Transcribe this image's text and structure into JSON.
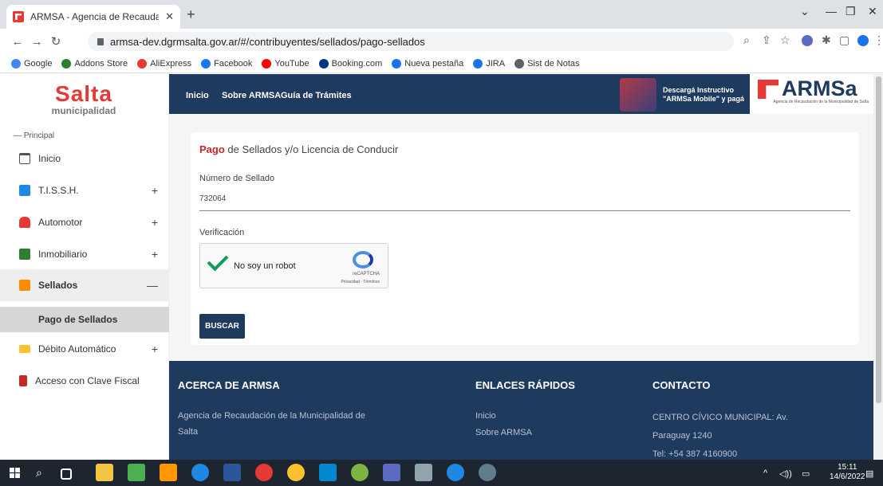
{
  "browser": {
    "tab_title": "ARMSA - Agencia de Recaudació",
    "tab_close": "✕",
    "new_tab": "+",
    "url": "armsa-dev.dgrmsalta.gov.ar/#/contribuyentes/sellados/pago-sellados",
    "window_controls": [
      "⌄",
      "—",
      "❐",
      "✕"
    ],
    "bookmarks": [
      {
        "label": "Google",
        "color": "#4285f4"
      },
      {
        "label": "Addons Store",
        "color": "#2e7d32"
      },
      {
        "label": "AliExpress",
        "color": "#e53935"
      },
      {
        "label": "Facebook",
        "color": "#1877f2"
      },
      {
        "label": "YouTube",
        "color": "#ff0000"
      },
      {
        "label": "Booking.com",
        "color": "#003580"
      },
      {
        "label": "Nueva pestaña",
        "color": "#1a73e8"
      },
      {
        "label": "JIRA",
        "color": "#1a73e8"
      },
      {
        "label": "Sist de Notas",
        "color": "#5f6368"
      }
    ]
  },
  "logo": {
    "big": "Salta",
    "small": "municipalidad"
  },
  "sidebar": {
    "section": "— Principal",
    "items": [
      {
        "label": "Inicio",
        "icon": "home-icon",
        "color": "#555",
        "expand": ""
      },
      {
        "label": "T.I.S.S.H.",
        "icon": "store-icon",
        "color": "#1e88e5",
        "expand": "+"
      },
      {
        "label": "Automotor",
        "icon": "car-icon",
        "color": "#e53935",
        "expand": "+"
      },
      {
        "label": "Inmobiliario",
        "icon": "building-icon",
        "color": "#2e7d32",
        "expand": "+"
      },
      {
        "label": "Sellados",
        "icon": "stamp-icon",
        "color": "#fb8c00",
        "expand": "—"
      },
      {
        "label": "Débito Automático",
        "icon": "card-icon",
        "color": "#fbc02d",
        "expand": "+"
      },
      {
        "label": "Acceso con Clave Fiscal",
        "icon": "door-icon",
        "color": "#c62828",
        "expand": ""
      }
    ],
    "subitem": "Pago de Sellados"
  },
  "topnav": [
    "Inicio",
    "Sobre ARMSA",
    "Guía de Trámites"
  ],
  "promo": {
    "line1": "Descargá Instructivo",
    "line2": "\"ARMSa Mobile\" y pagá"
  },
  "brand": {
    "name": "ARMSa",
    "sub": "Agencia de Recaudación de la Municipalidad de Salta"
  },
  "form": {
    "title_accent": "Pago",
    "title_rest": " de Sellados y/o Licencia de Conducir",
    "number_label": "Número de Sellado",
    "number_value": "732064",
    "verify_label": "Verificación",
    "captcha_text": "No soy un robot",
    "captcha_brand": "reCAPTCHA",
    "captcha_terms": "Privacidad - Términos",
    "button": "BUSCAR"
  },
  "footer": {
    "about_title": "ACERCA DE ARMSA",
    "about_text_1": "Agencia de Recaudación de la Municipalidad de",
    "about_text_2": "Salta",
    "links_title": "ENLACES RÁPIDOS",
    "links": [
      "Inicio",
      "Sobre ARMSA"
    ],
    "contact_title": "CONTACTO",
    "contact": [
      "CENTRO CÍVICO MUNICIPAL: Av.",
      "Paraguay 1240",
      "Tel: +54 387 4160900"
    ]
  },
  "taskbar": {
    "time": "15:11",
    "date": "14/6/2022"
  }
}
